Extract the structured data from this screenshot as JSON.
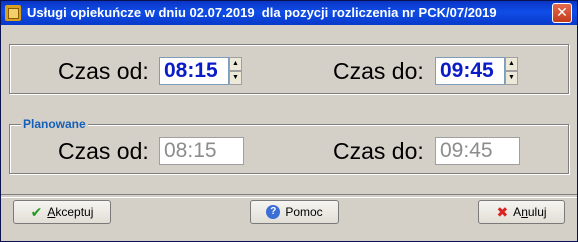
{
  "window": {
    "title": "Usługi opiekuńcze w dniu 02.07.2019  dla pozycji rozliczenia nr PCK/07/2019",
    "close_label": "✕"
  },
  "actual": {
    "from_label": "Czas od:",
    "from_value": "08:15",
    "to_label": "Czas do:",
    "to_value": "09:45"
  },
  "planned": {
    "group_label": "Planowane",
    "from_label": "Czas od:",
    "from_value": "08:15",
    "to_label": "Czas do:",
    "to_value": "09:45"
  },
  "buttons": {
    "accept_first": "A",
    "accept_rest": "kceptuj",
    "help": "Pomoc",
    "cancel_first": "A",
    "cancel_u": "n",
    "cancel_rest": "uluj"
  },
  "icons": {
    "spin_up": "▲",
    "spin_down": "▼",
    "check": "✔",
    "help": "?",
    "cancel": "✖"
  },
  "colors": {
    "titlebar": "#0f4de8",
    "time_active": "#0a1cc8",
    "group_label": "#1560b8"
  }
}
